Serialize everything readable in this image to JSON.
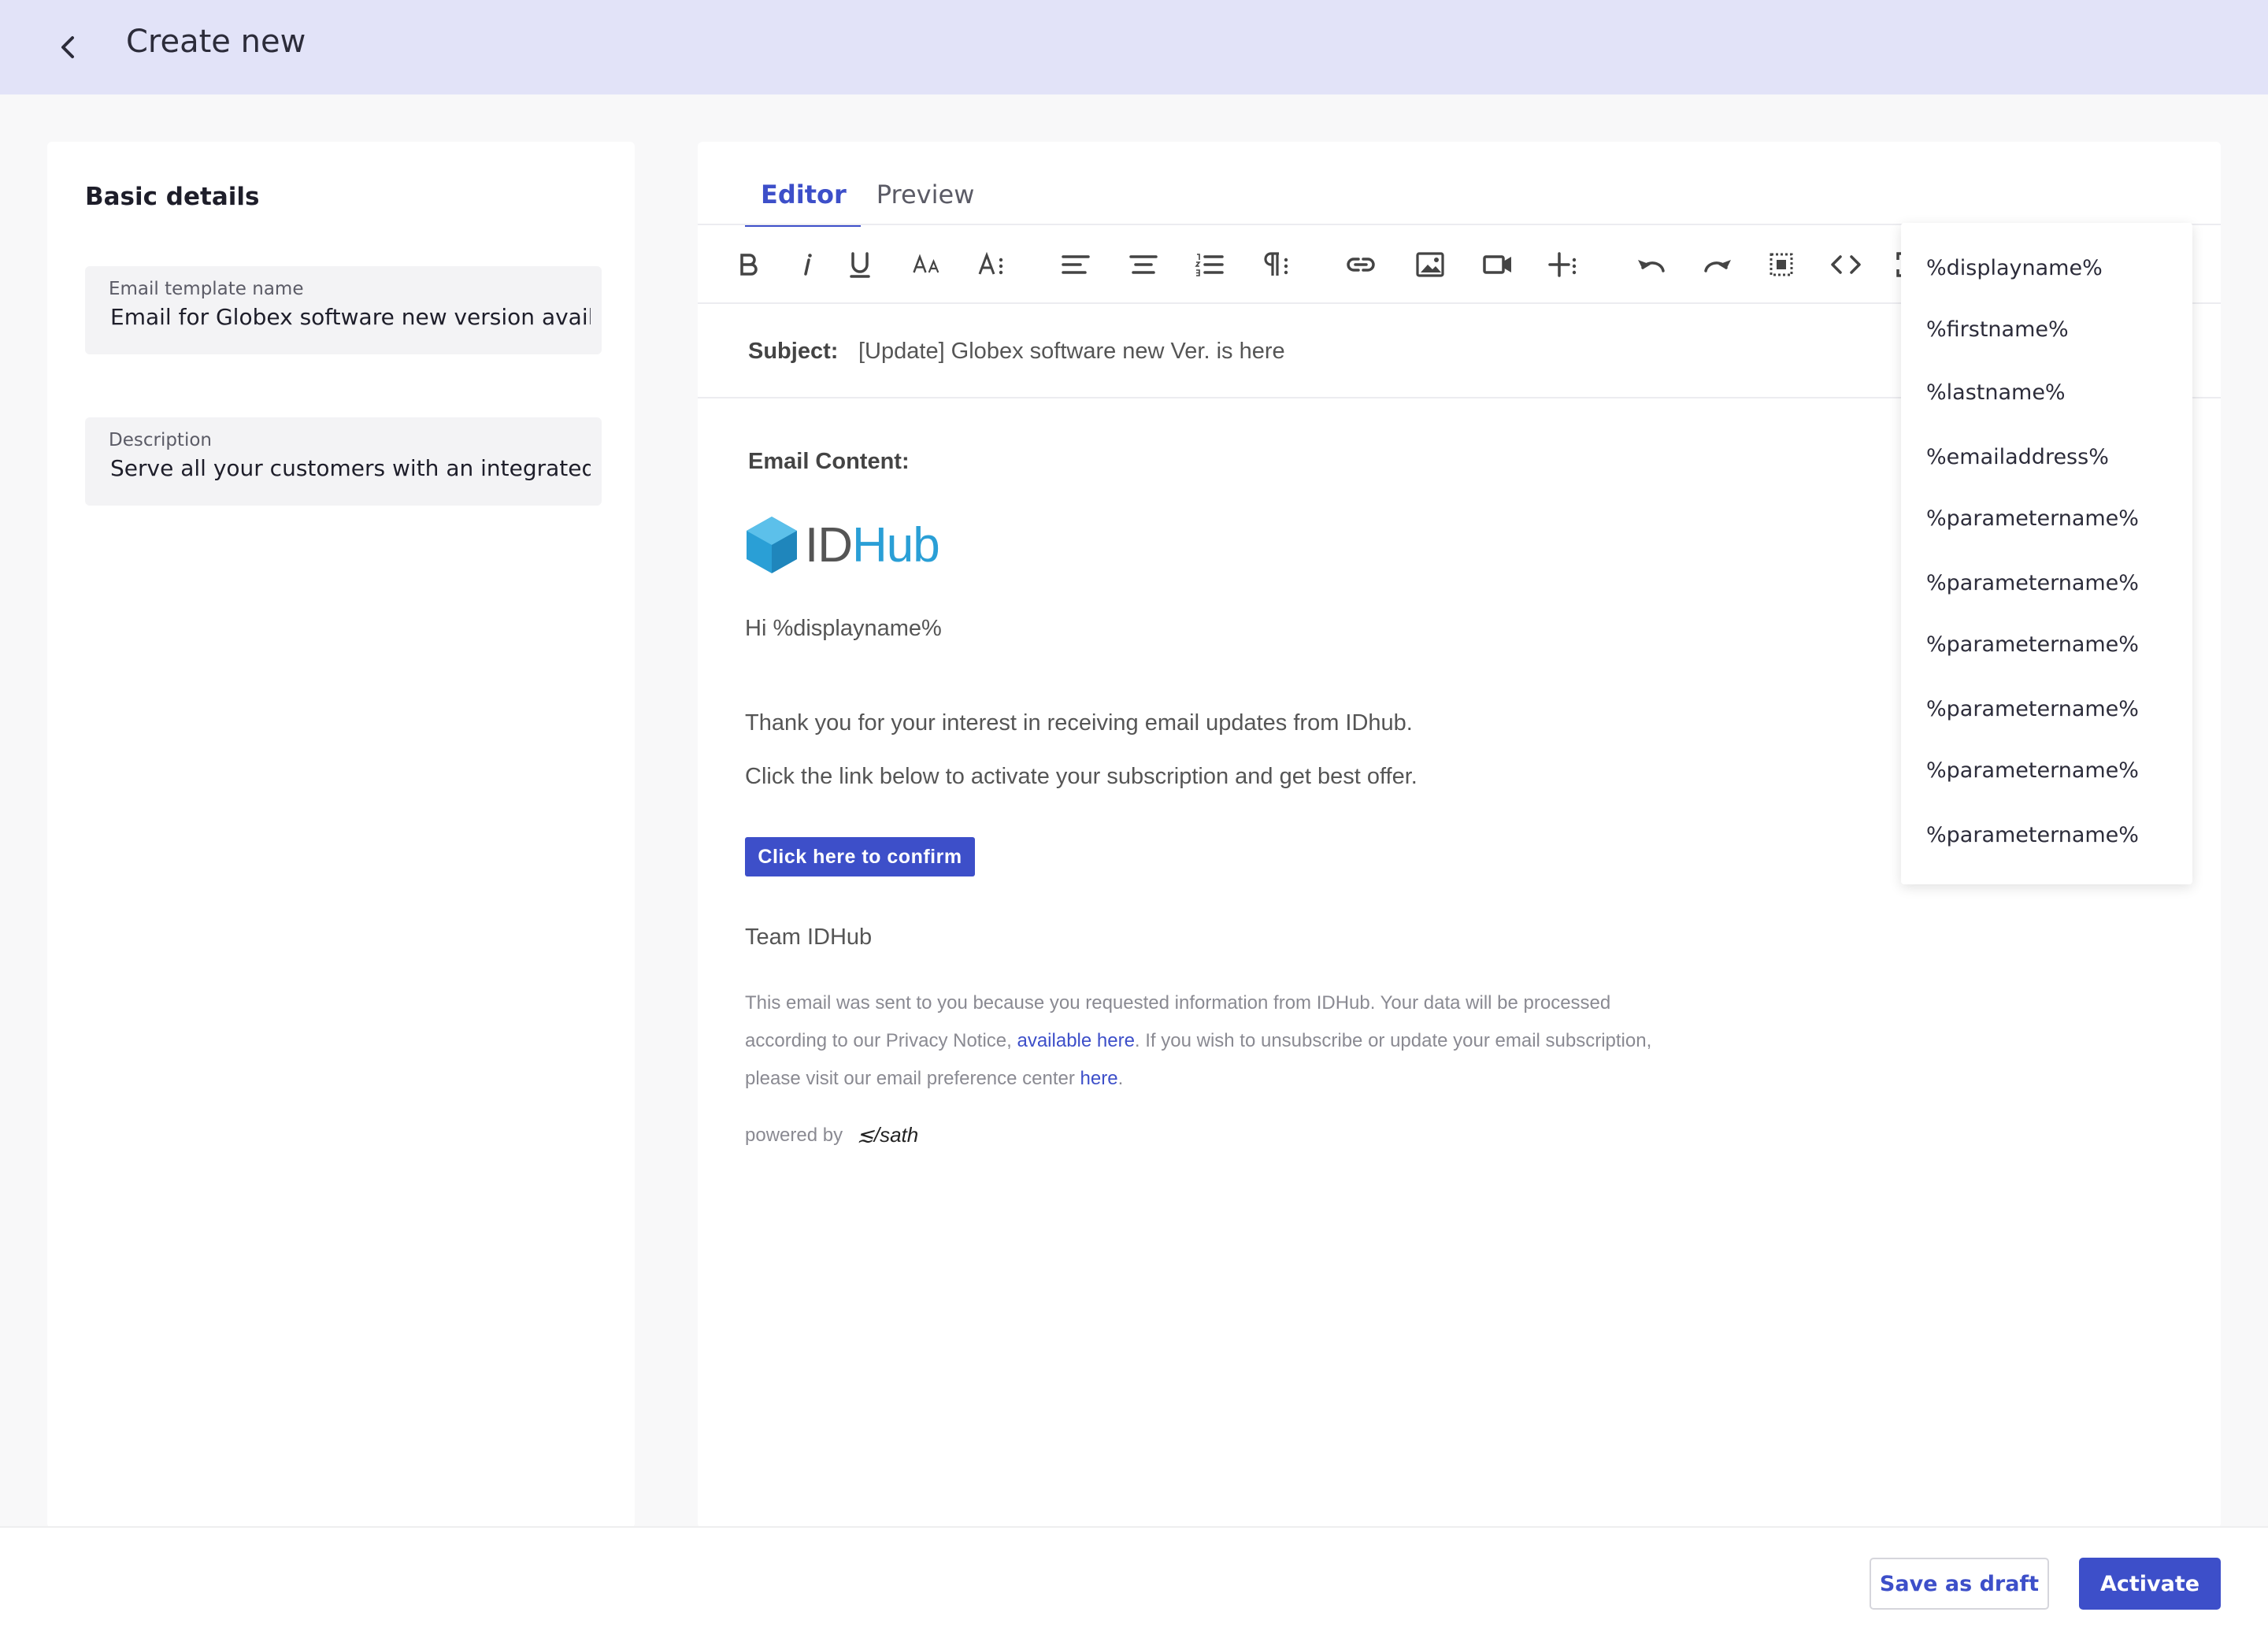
{
  "header": {
    "title": "Create new"
  },
  "basic_details": {
    "title": "Basic details",
    "template_name_label": "Email template name",
    "template_name_value": "Email for Globex software new version available",
    "description_label": "Description",
    "description_value": "Serve all your customers with an integrated"
  },
  "tabs": [
    {
      "label": "Editor",
      "active": true
    },
    {
      "label": "Preview",
      "active": false
    }
  ],
  "toolbar": {
    "icons": [
      "bold-icon",
      "italic-icon",
      "underline-icon",
      "font-size-icon",
      "font-style-icon",
      "align-left-icon",
      "align-center-icon",
      "ordered-list-icon",
      "paragraph-format-icon",
      "link-icon",
      "image-icon",
      "video-icon",
      "insert-more-icon",
      "undo-icon",
      "redo-icon",
      "select-all-icon",
      "code-view-icon",
      "fullscreen-icon"
    ]
  },
  "subject": {
    "label": "Subject:",
    "value": "[Update] Globex software new Ver. is here"
  },
  "email": {
    "content_label": "Email Content:",
    "logo_id": "ID",
    "logo_hub": "Hub",
    "greeting": "Hi %displayname%",
    "line1": "Thank you for your interest in receiving email updates from IDhub.",
    "line2": "Click the link below to activate your subscription and get best offer.",
    "cta_label": "Click here to confirm",
    "signoff": "Team IDHub",
    "footer_part1": "This email was sent to you because you requested information from IDHub. Your data will be processed according to our Privacy Notice, ",
    "footer_link1": "available here",
    "footer_part2": ". If you wish to unsubscribe or update your email subscription, please visit our email preference center ",
    "footer_link2": "here",
    "footer_part3": ".",
    "powered_by": "powered by",
    "powered_brand": "≲/sath"
  },
  "placeholders": [
    "%displayname%",
    "%firstname%",
    "%lastname%",
    "%emailaddress%",
    "%parametername%",
    "%parametername%",
    "%parametername%",
    "%parametername%",
    "%parametername%",
    "%parametername%"
  ],
  "actions": {
    "save_draft": "Save as draft",
    "activate": "Activate"
  },
  "colors": {
    "accent": "#3d4fc9",
    "header_bg": "#e2e3f8",
    "logo_blue": "#2a9fd6"
  }
}
